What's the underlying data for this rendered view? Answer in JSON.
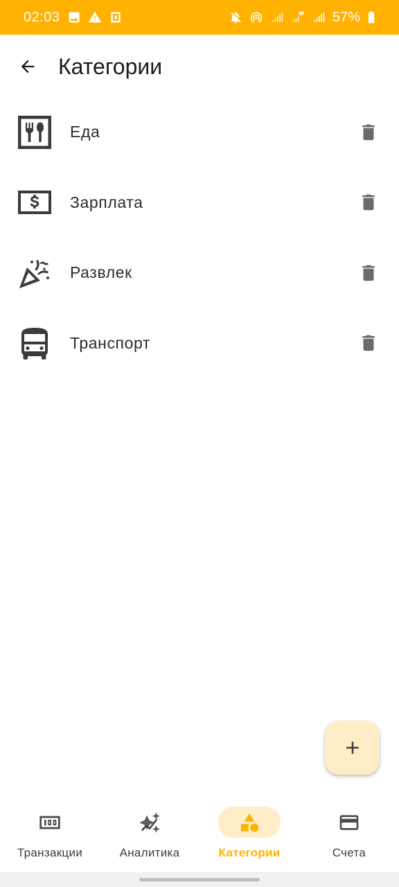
{
  "status_bar": {
    "time": "02:03",
    "battery": "57%",
    "left_icons": [
      "gallery-icon",
      "warning-icon",
      "screenshot-icon"
    ],
    "right_icons": [
      "mute-icon",
      "hotspot-icon",
      "signal-icon",
      "lte-signal-icon",
      "signal-icon"
    ],
    "background_color": "#FFB300"
  },
  "app_bar": {
    "title": "Категории",
    "back_icon": "arrow-back-icon"
  },
  "categories": [
    {
      "label": "Еда",
      "icon": "restaurant-icon"
    },
    {
      "label": "Зарплата",
      "icon": "money-icon"
    },
    {
      "label": "Развлек",
      "icon": "celebration-icon"
    },
    {
      "label": "Транспорт",
      "icon": "bus-icon"
    }
  ],
  "fab": {
    "icon": "add-icon"
  },
  "bottom_nav": {
    "items": [
      {
        "label": "Транзакции",
        "icon": "transactions-icon",
        "active": false
      },
      {
        "label": "Аналитика",
        "icon": "analytics-icon",
        "active": false
      },
      {
        "label": "Категории",
        "icon": "categories-icon",
        "active": true
      },
      {
        "label": "Счета",
        "icon": "card-icon",
        "active": false
      }
    ]
  },
  "colors": {
    "accent": "#FFB300",
    "accent_container": "#FFEDC7",
    "icon": "#3a3a3f",
    "delete_icon": "#6a6a6a"
  }
}
